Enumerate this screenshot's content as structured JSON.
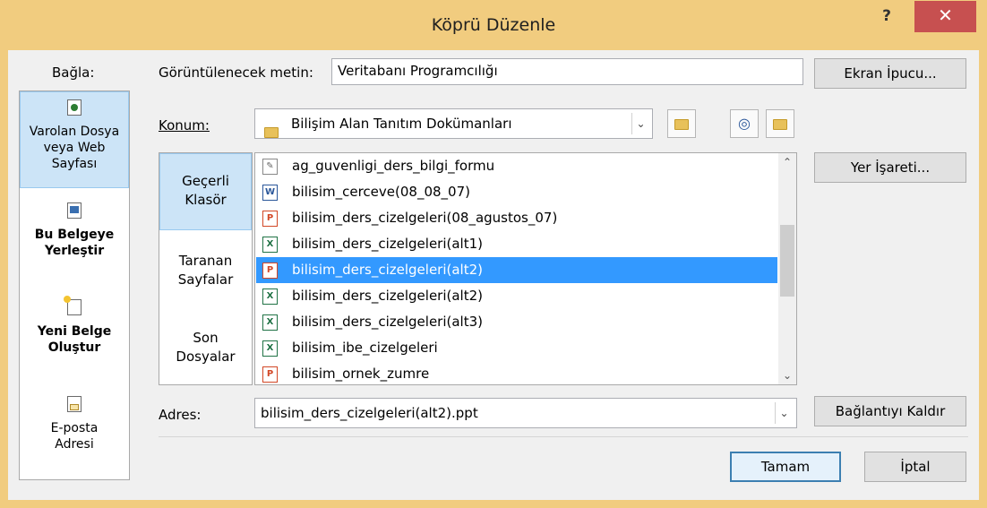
{
  "window": {
    "title": "Köprü Düzenle",
    "help_label": "?",
    "close_label": "✕"
  },
  "link_to": {
    "heading": "Bağla:",
    "items": [
      {
        "label": "Varolan Dosya veya Web Sayfası",
        "icon": "existing-file-icon",
        "selected": true
      },
      {
        "label": "Bu Belgeye Yerleştir",
        "icon": "place-in-document-icon",
        "selected": false
      },
      {
        "label": "Yeni Belge Oluştur",
        "icon": "new-document-icon",
        "selected": false
      },
      {
        "label": "E-posta Adresi",
        "icon": "email-icon",
        "selected": false
      }
    ]
  },
  "display_text": {
    "label": "Görüntülenecek metin:",
    "value": "Veritabanı Programcılığı"
  },
  "screen_tip_button": "Ekran İpucu...",
  "look_in": {
    "label": "Konum:",
    "value": "Bilişim Alan Tanıtım Dokümanları"
  },
  "tabs": [
    {
      "label": "Geçerli Klasör",
      "selected": true
    },
    {
      "label": "Taranan Sayfalar",
      "selected": false
    },
    {
      "label": "Son Dosyalar",
      "selected": false
    }
  ],
  "files": [
    {
      "name": "ag_guvenligi_ders_bilgi_formu",
      "icon": "edit-doc-icon",
      "selected": false
    },
    {
      "name": "bilisim_cerceve(08_08_07)",
      "icon": "word-icon",
      "selected": false
    },
    {
      "name": "bilisim_ders_cizelgeleri(08_agustos_07)",
      "icon": "powerpoint-icon",
      "selected": false
    },
    {
      "name": "bilisim_ders_cizelgeleri(alt1)",
      "icon": "excel-icon",
      "selected": false
    },
    {
      "name": "bilisim_ders_cizelgeleri(alt2)",
      "icon": "powerpoint-icon",
      "selected": true
    },
    {
      "name": "bilisim_ders_cizelgeleri(alt2)",
      "icon": "excel-icon",
      "selected": false
    },
    {
      "name": "bilisim_ders_cizelgeleri(alt3)",
      "icon": "excel-icon",
      "selected": false
    },
    {
      "name": "bilisim_ibe_cizelgeleri",
      "icon": "excel-icon",
      "selected": false
    },
    {
      "name": "bilisim_ornek_zumre",
      "icon": "powerpoint-icon",
      "selected": false
    }
  ],
  "bookmark_button": "Yer İşareti...",
  "address": {
    "label": "Adres:",
    "value": "bilisim_ders_cizelgeleri(alt2).ppt"
  },
  "remove_link_button": "Bağlantıyı Kaldır",
  "ok_button": "Tamam",
  "cancel_button": "İptal",
  "colors": {
    "title_bar": "#f1cc7f",
    "close": "#c75050",
    "selection": "#3399ff",
    "tab_selected": "#cce4f7"
  }
}
